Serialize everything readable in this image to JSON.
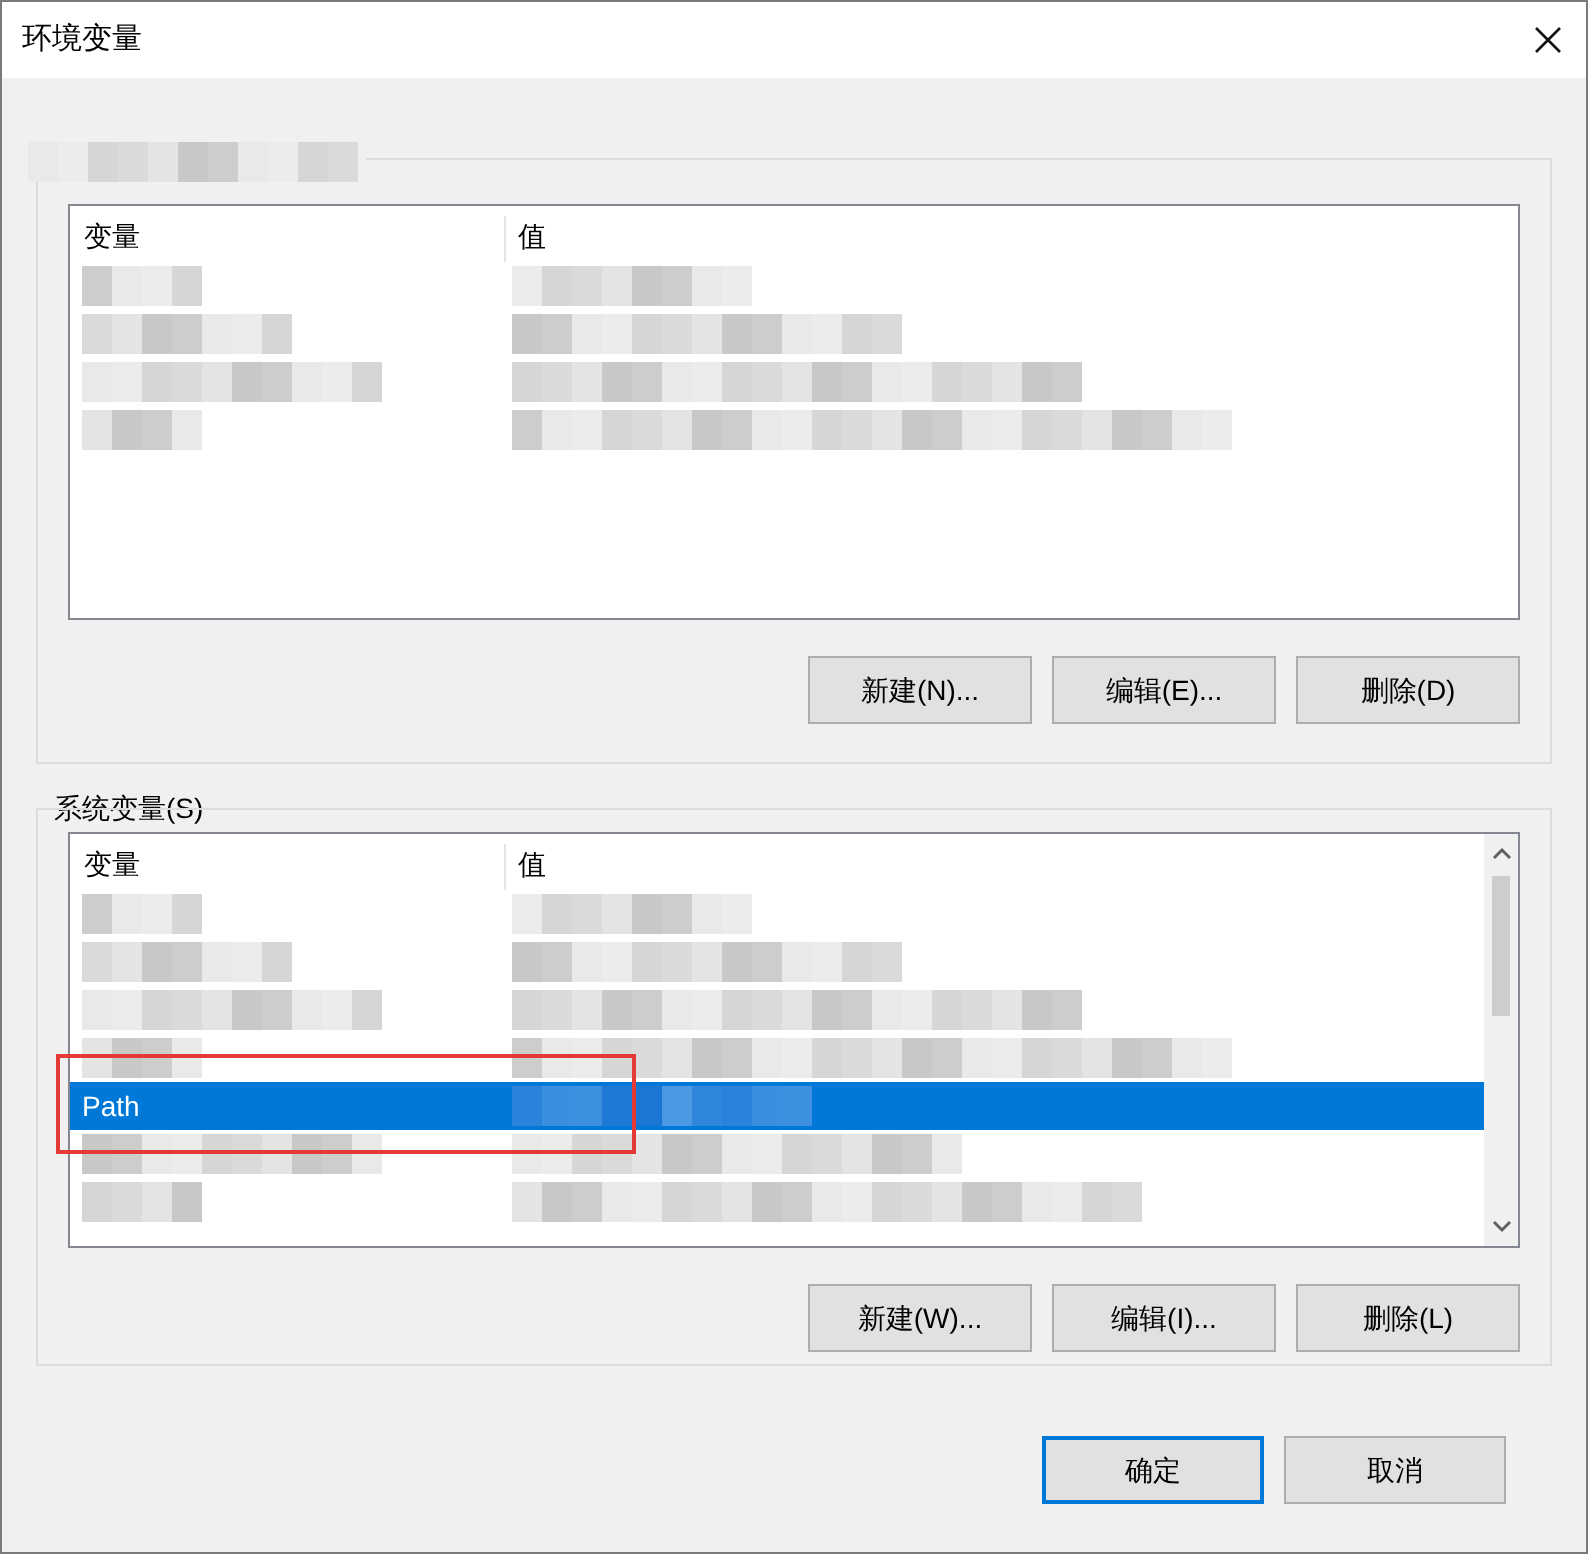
{
  "window": {
    "title": "环境变量"
  },
  "user_vars": {
    "columns": [
      "变量",
      "值"
    ],
    "rows": [
      {
        "kind": "redacted",
        "selected": false
      },
      {
        "kind": "redacted",
        "selected": false
      },
      {
        "kind": "redacted",
        "selected": false
      },
      {
        "kind": "redacted",
        "selected": false
      }
    ],
    "buttons": [
      "新建(N)...",
      "编辑(E)...",
      "删除(D)"
    ]
  },
  "system_vars": {
    "title": "系统变量(S)",
    "columns": [
      "变量",
      "值"
    ],
    "rows": [
      {
        "kind": "redacted",
        "selected": false
      },
      {
        "kind": "redacted",
        "selected": false
      },
      {
        "kind": "redacted",
        "selected": false
      },
      {
        "kind": "redacted",
        "selected": false
      },
      {
        "kind": "text",
        "name": "Path",
        "selected": true,
        "highlighted": true
      },
      {
        "kind": "redacted",
        "selected": false
      },
      {
        "kind": "redacted",
        "selected": false
      }
    ],
    "buttons": [
      "新建(W)...",
      "编辑(I)...",
      "删除(L)"
    ]
  },
  "buttons": [
    {
      "label": "确定",
      "default": true
    },
    {
      "label": "取消",
      "default": false
    }
  ]
}
